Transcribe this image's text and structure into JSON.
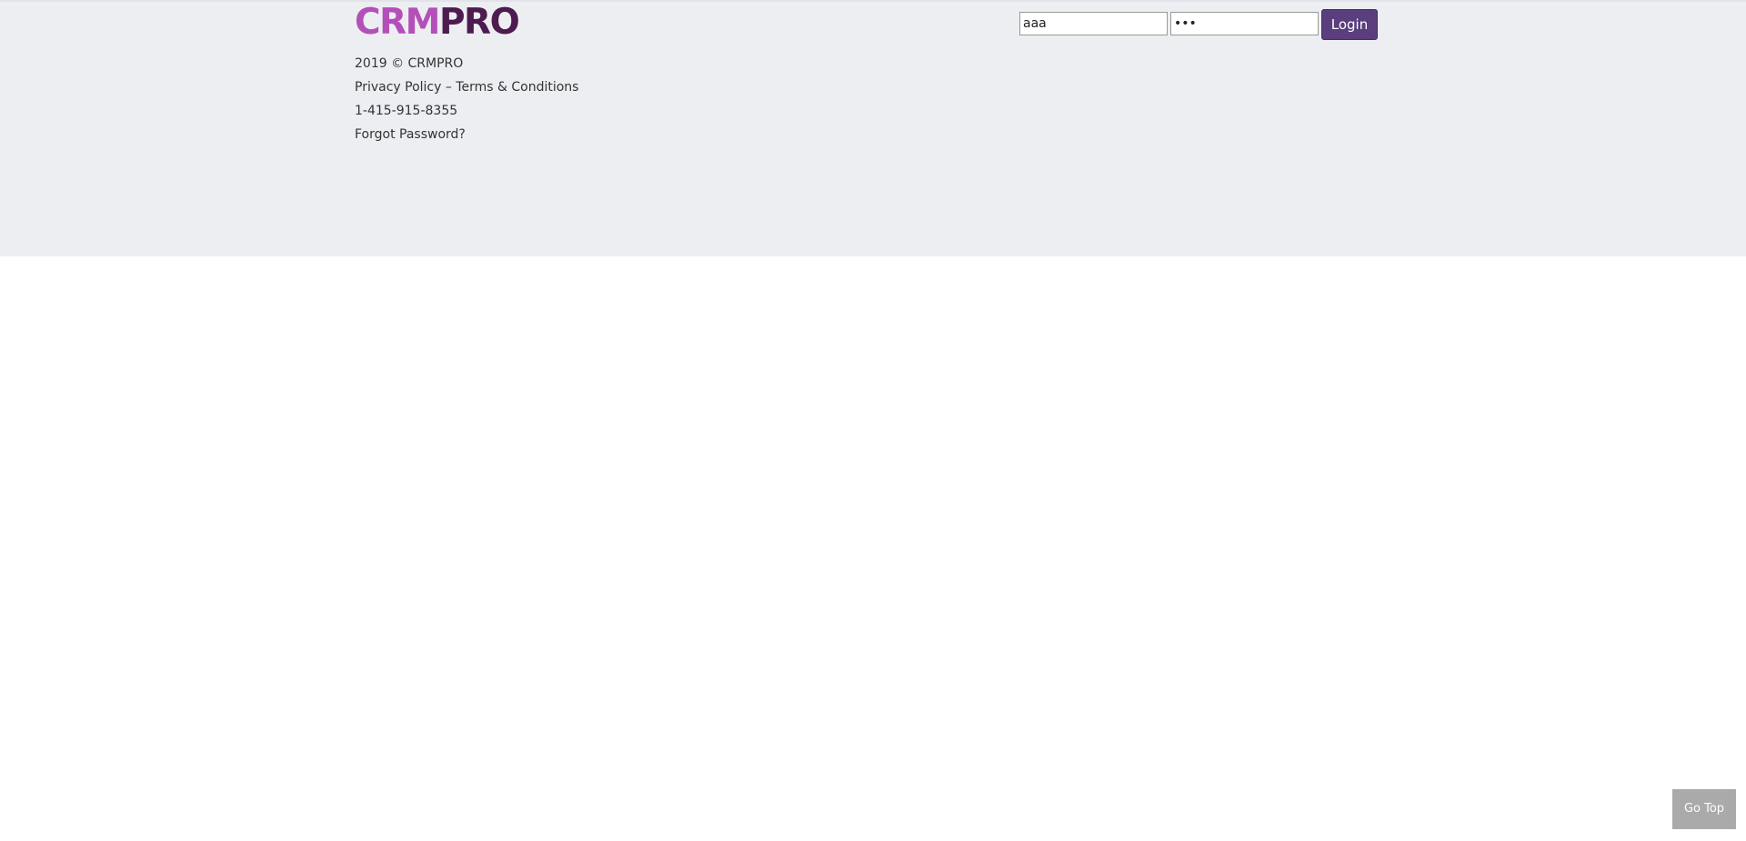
{
  "logo": {
    "part_a": "CRM",
    "part_b": "PRO"
  },
  "footer": {
    "copyright": "2019 © CRMPRO",
    "policy_links": "Privacy Policy – Terms & Conditions",
    "phone": "1-415-915-8355",
    "forgot_password": "Forgot Password?"
  },
  "login": {
    "username_value": "aaa",
    "password_value": "aaa",
    "button_label": "Login"
  },
  "go_top": {
    "label": "Go Top"
  },
  "colors": {
    "header_background": "#edeef2",
    "logo_light": "#b44fb9",
    "logo_dark": "#4d1b4f",
    "login_button": "#5a3e7e",
    "go_top_background": "#aaaaaa"
  }
}
